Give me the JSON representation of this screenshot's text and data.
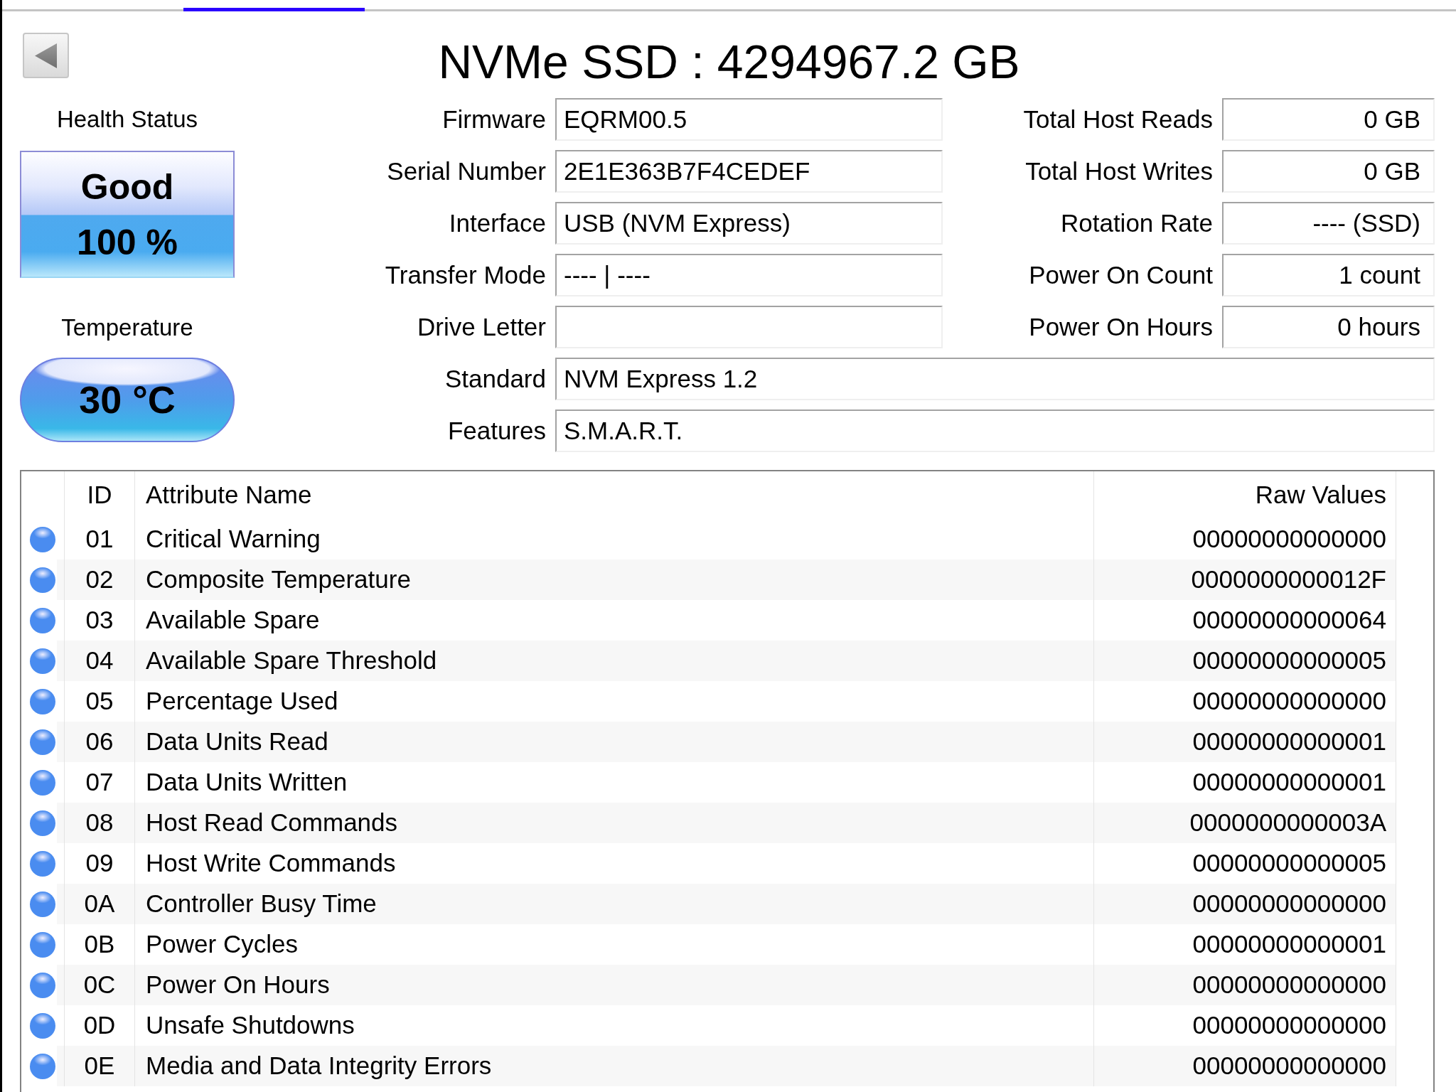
{
  "tabs": [
    {
      "selected": false
    },
    {
      "selected": true
    }
  ],
  "title": "NVMe SSD : 4294967.2 GB",
  "health": {
    "label": "Health Status",
    "status_text": "Good",
    "percent": "100 %"
  },
  "temperature": {
    "label": "Temperature",
    "value": "30 °C"
  },
  "drive_info": [
    {
      "label": "Firmware",
      "value": "EQRM00.5"
    },
    {
      "label": "Serial Number",
      "value": "2E1E363B7F4CEDEF"
    },
    {
      "label": "Interface",
      "value": "USB (NVM Express)"
    },
    {
      "label": "Transfer Mode",
      "value": "---- | ----"
    },
    {
      "label": "Drive Letter"
    }
  ],
  "counters": [
    {
      "label": "Total Host Reads",
      "value": "0 GB"
    },
    {
      "label": "Total Host Writes",
      "value": "0 GB"
    },
    {
      "label": "Rotation Rate",
      "value": "---- (SSD)"
    },
    {
      "label": "Power On Count",
      "value": "1 count"
    },
    {
      "label": "Power On Hours",
      "value": "0 hours"
    }
  ],
  "spec_info": [
    {
      "label": "Standard",
      "value": "NVM Express 1.2"
    },
    {
      "label": "Features",
      "value": "S.M.A.R.T."
    }
  ],
  "smart_table": {
    "columns": [
      "ID",
      "Attribute Name",
      "Raw Values"
    ],
    "rows": [
      {
        "color": "#4a8cf0",
        "id": "01",
        "name": "Critical Warning",
        "raw": "00000000000000"
      },
      {
        "color": "#4a8cf0",
        "id": "02",
        "name": "Composite Temperature",
        "raw": "0000000000012F"
      },
      {
        "color": "#4a8cf0",
        "id": "03",
        "name": "Available Spare",
        "raw": "00000000000064"
      },
      {
        "color": "#4a8cf0",
        "id": "04",
        "name": "Available Spare Threshold",
        "raw": "00000000000005"
      },
      {
        "color": "#4a8cf0",
        "id": "05",
        "name": "Percentage Used",
        "raw": "00000000000000"
      },
      {
        "color": "#4a8cf0",
        "id": "06",
        "name": "Data Units Read",
        "raw": "00000000000001"
      },
      {
        "color": "#4a8cf0",
        "id": "07",
        "name": "Data Units Written",
        "raw": "00000000000001"
      },
      {
        "color": "#4a8cf0",
        "id": "08",
        "name": "Host Read Commands",
        "raw": "0000000000003A"
      },
      {
        "color": "#4a8cf0",
        "id": "09",
        "name": "Host Write Commands",
        "raw": "00000000000005"
      },
      {
        "color": "#4a8cf0",
        "id": "0A",
        "name": "Controller Busy Time",
        "raw": "00000000000000"
      },
      {
        "color": "#4a8cf0",
        "id": "0B",
        "name": "Power Cycles",
        "raw": "00000000000001"
      },
      {
        "color": "#4a8cf0",
        "id": "0C",
        "name": "Power On Hours",
        "raw": "00000000000000"
      },
      {
        "color": "#4a8cf0",
        "id": "0D",
        "name": "Unsafe Shutdowns",
        "raw": "00000000000000"
      },
      {
        "color": "#4a8cf0",
        "id": "0E",
        "name": "Media and Data Integrity Errors",
        "raw": "00000000000000"
      }
    ]
  }
}
